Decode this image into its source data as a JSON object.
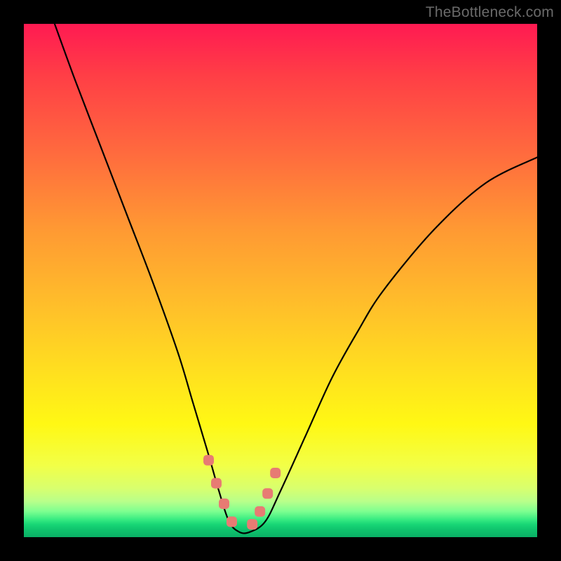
{
  "watermark": "TheBottleneck.com",
  "chart_data": {
    "type": "line",
    "title": "",
    "xlabel": "",
    "ylabel": "",
    "xlim": [
      0,
      100
    ],
    "ylim": [
      0,
      100
    ],
    "series": [
      {
        "name": "bottleneck-curve",
        "x": [
          6,
          10,
          15,
          20,
          25,
          30,
          33,
          36,
          38,
          40,
          42,
          44,
          47,
          50,
          55,
          60,
          65,
          70,
          80,
          90,
          100
        ],
        "values": [
          100,
          89,
          76,
          63,
          50,
          36,
          26,
          16,
          9,
          3,
          1,
          1,
          3,
          9,
          20,
          31,
          40,
          48,
          60,
          69,
          74
        ]
      }
    ],
    "markers": {
      "name": "highlighted-points",
      "color": "#e77b73",
      "x": [
        36.0,
        37.5,
        39.0,
        40.5,
        44.5,
        46.0,
        47.5,
        49.0
      ],
      "values": [
        15.0,
        10.5,
        6.5,
        3.0,
        2.5,
        5.0,
        8.5,
        12.5
      ]
    },
    "bottom_band": {
      "name": "green-band",
      "y_start": 0,
      "y_end": 4
    }
  }
}
